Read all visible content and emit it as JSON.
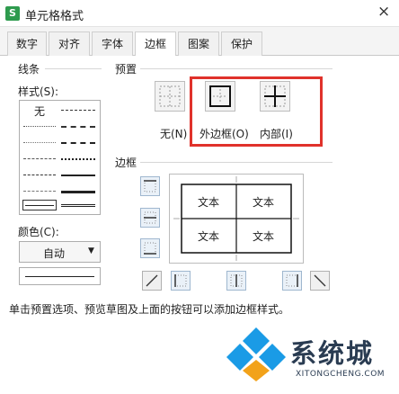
{
  "window": {
    "title": "单元格格式",
    "close_label": "×",
    "app_icon": "S"
  },
  "tabs": [
    {
      "label": "数字"
    },
    {
      "label": "对齐"
    },
    {
      "label": "字体"
    },
    {
      "label": "边框",
      "active": true
    },
    {
      "label": "图案"
    },
    {
      "label": "保护"
    }
  ],
  "line_group": {
    "title": "线条",
    "style_label": "样式(S):",
    "style_none": "无",
    "color_label": "颜色(C):",
    "color_value": "自动",
    "dropdown_arrow": "▼"
  },
  "preset_group": {
    "title": "预置",
    "items": [
      {
        "label": "无(N)",
        "icon": "no-border-icon"
      },
      {
        "label": "外边框(O)",
        "icon": "outline-border-icon"
      },
      {
        "label": "内部(I)",
        "icon": "inside-border-icon"
      }
    ]
  },
  "border_group": {
    "title": "边框",
    "cell_texts": [
      "文本",
      "文本",
      "文本",
      "文本"
    ]
  },
  "footer_text": "单击预置选项、预览草图及上面的按钮可以添加边框样式。",
  "watermark": {
    "text": "系统城",
    "url": "XITONGCHENG.COM",
    "accent": "#1a9be6"
  },
  "colors": {
    "highlight": "#e0322b",
    "tab_active": "#ffffff"
  }
}
